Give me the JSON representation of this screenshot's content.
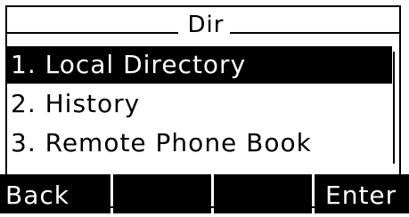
{
  "header": {
    "title": "Dir"
  },
  "menu": {
    "items": [
      {
        "label": "1. Local Directory",
        "selected": true
      },
      {
        "label": "2. History",
        "selected": false
      },
      {
        "label": "3. Remote Phone Book",
        "selected": false
      }
    ]
  },
  "softkeys": {
    "key1": "Back",
    "key2": "",
    "key3": "",
    "key4": "Enter"
  },
  "colors": {
    "background": "#ffffff",
    "foreground": "#000000",
    "highlight": "#000000",
    "highlight_text": "#ffffff"
  }
}
